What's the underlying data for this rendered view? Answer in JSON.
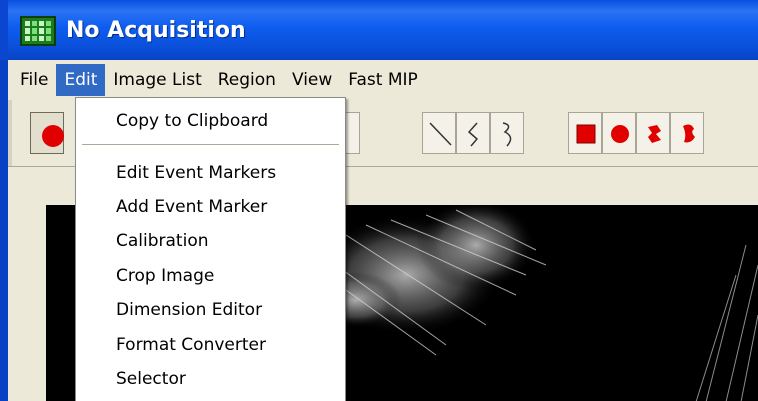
{
  "window": {
    "title": "No Acquisition"
  },
  "menubar": {
    "items": [
      "File",
      "Edit",
      "Image List",
      "Region",
      "View",
      "Fast MIP"
    ],
    "active_index": 1
  },
  "edit_menu": {
    "items": [
      "Copy to Clipboard",
      "Edit Event Markers",
      "Add Event Marker",
      "Calibration",
      "Crop Image",
      "Dimension Editor",
      "Format Converter",
      "Selector"
    ],
    "separator_after_index": 0
  },
  "toolbar": {
    "icons": [
      "apple-icon",
      "cross-icon",
      "line-tool-icon",
      "freehand-tool-icon",
      "freehand-tool-2-icon",
      "rectangle-region-icon",
      "ellipse-region-icon",
      "polygon-region-icon",
      "freehand-region-icon"
    ],
    "accent_color": "#ff0000"
  },
  "colors": {
    "titlebar": "#0a4fe0",
    "menu_highlight": "#316ac5",
    "chrome": "#ece9d8"
  }
}
